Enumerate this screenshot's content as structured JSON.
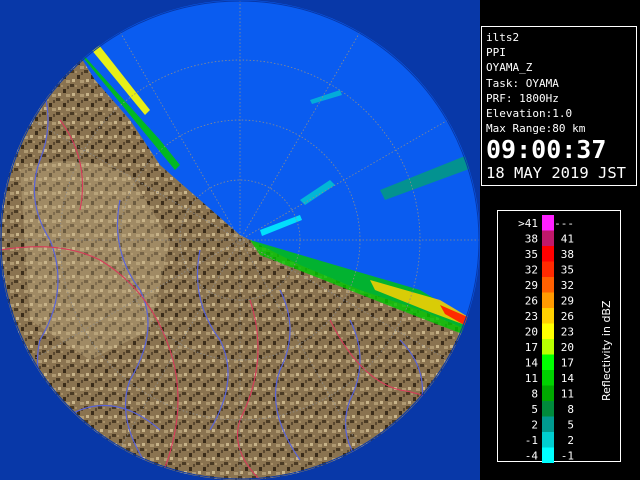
{
  "info": {
    "product": "ilts2",
    "scan_type": "PPI",
    "site": "OYAMA_Z",
    "task": "Task: OYAMA",
    "prf": "PRF: 1800Hz",
    "elevation": "Elevation:1.0",
    "max_range": "Max Range:80 km",
    "time": "09:00:37",
    "date": "18 MAY 2019 JST"
  },
  "legend": {
    "title": "Reflectivity in dBZ",
    "rows": [
      {
        "lo": ">41",
        "hi": "---",
        "color": "#ff20ff"
      },
      {
        "lo": "38",
        "hi": "41",
        "color": "#c0186a"
      },
      {
        "lo": "35",
        "hi": "38",
        "color": "#ff0000"
      },
      {
        "lo": "32",
        "hi": "35",
        "color": "#ff2a00"
      },
      {
        "lo": "29",
        "hi": "32",
        "color": "#ff6000"
      },
      {
        "lo": "26",
        "hi": "29",
        "color": "#ff9a00"
      },
      {
        "lo": "23",
        "hi": "26",
        "color": "#ffd000"
      },
      {
        "lo": "20",
        "hi": "23",
        "color": "#ffff00"
      },
      {
        "lo": "17",
        "hi": "20",
        "color": "#b8ff00"
      },
      {
        "lo": "14",
        "hi": "17",
        "color": "#00ff00"
      },
      {
        "lo": "11",
        "hi": "14",
        "color": "#00d200"
      },
      {
        "lo": "8",
        "hi": "11",
        "color": "#00a800"
      },
      {
        "lo": "5",
        "hi": "8",
        "color": "#008a3c"
      },
      {
        "lo": "2",
        "hi": "5",
        "color": "#009a90"
      },
      {
        "lo": "-1",
        "hi": "2",
        "color": "#00cdd0"
      },
      {
        "lo": "-4",
        "hi": "-1",
        "color": "#00ffff"
      }
    ]
  },
  "map": {
    "ocean_color": "#0a5cf0",
    "outside_color": "#0838a8",
    "land_color": "#8a7350"
  }
}
